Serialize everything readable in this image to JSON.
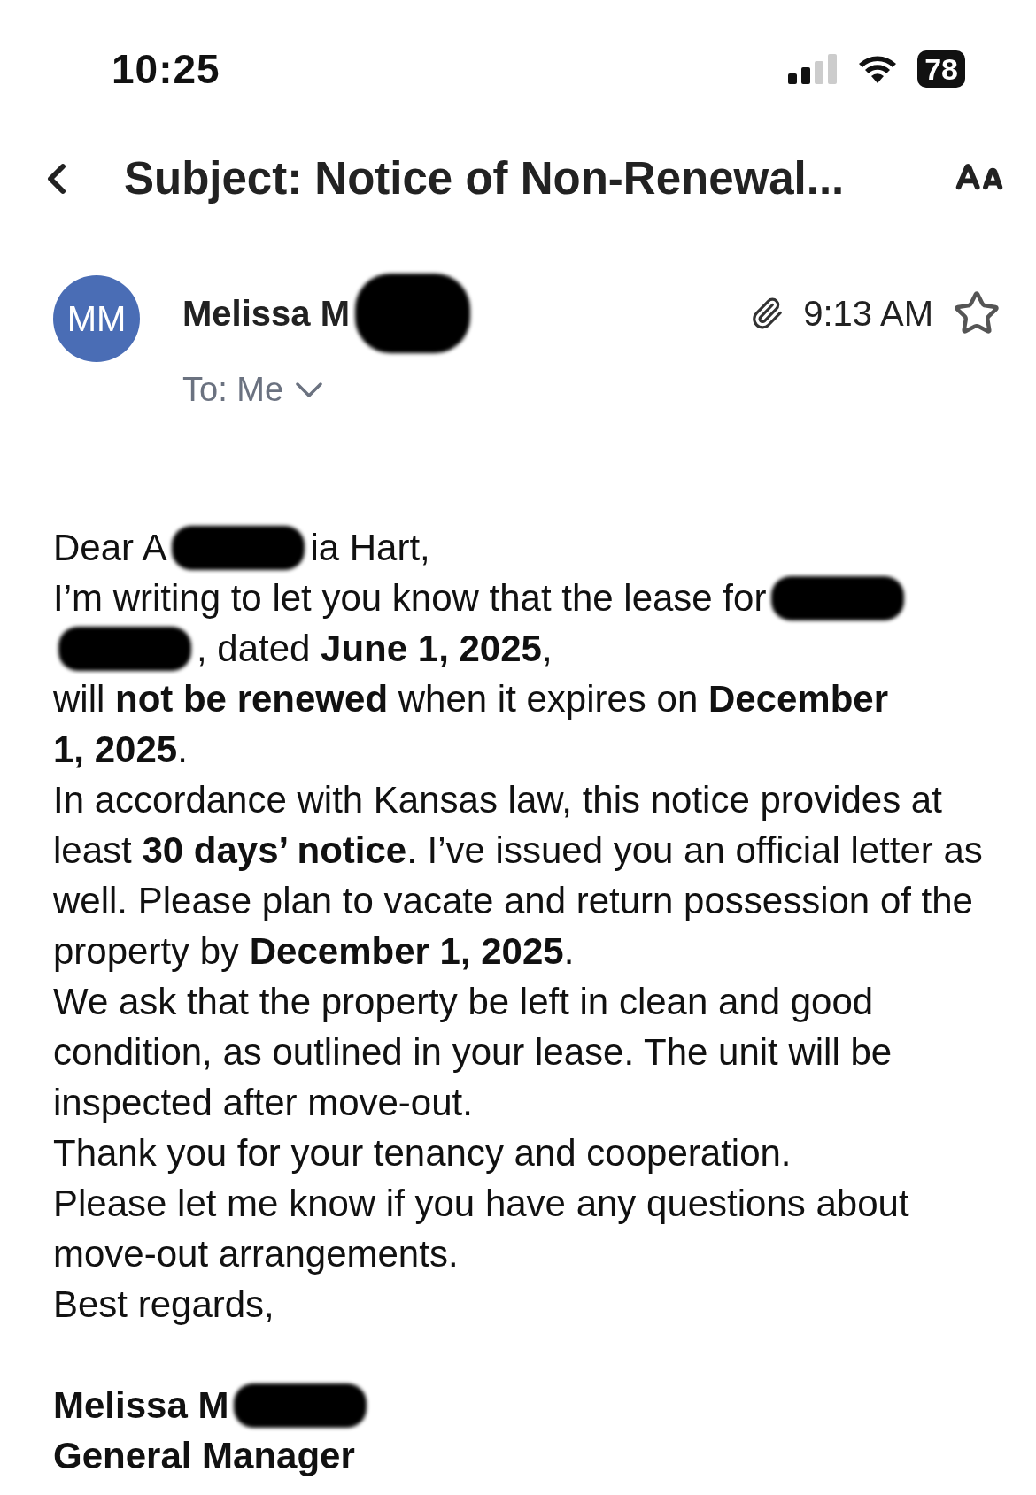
{
  "status_bar": {
    "time": "10:25",
    "battery": "78"
  },
  "header": {
    "title": "Subject: Notice of Non-Renewal..."
  },
  "sender": {
    "initials": "MM",
    "name": [
      {
        "kind": "text",
        "text": "Melissa M"
      },
      {
        "kind": "redaction"
      }
    ],
    "recipient": "To: Me",
    "time": "9:13 AM",
    "has_attachment": true,
    "starred": false
  },
  "body": [
    {
      "kind": "line",
      "segments": [
        {
          "kind": "text",
          "text": "Dear A"
        },
        {
          "kind": "redaction"
        },
        {
          "kind": "text",
          "text": "ia Hart,"
        }
      ]
    },
    {
      "kind": "line",
      "segments": [
        {
          "kind": "text",
          "text": "I’m writing to let you know that the lease for"
        },
        {
          "kind": "redaction"
        }
      ]
    },
    {
      "kind": "line",
      "segments": [
        {
          "kind": "redaction"
        },
        {
          "kind": "text",
          "text": ", dated **June 1, 2025**,"
        }
      ]
    },
    {
      "kind": "line",
      "segments": [
        {
          "kind": "text",
          "text": "will **not be renewed** when it expires on **December**"
        }
      ]
    },
    {
      "kind": "line",
      "segments": [
        {
          "kind": "text",
          "text": "**1, 2025**."
        }
      ]
    },
    {
      "kind": "paragraph",
      "text": "In accordance with Kansas law, this notice provides at least **30 days’ notice**. I’ve issued you an official letter as well. Please plan to vacate and return possession of the property by **December 1, 2025**."
    },
    {
      "kind": "paragraph",
      "text": "We ask that the property be left in clean and good condition, as outlined in your lease. The unit will be inspected after move-out."
    },
    {
      "kind": "paragraph",
      "text": "Thank you for your tenancy and cooperation."
    },
    {
      "kind": "paragraph",
      "text": "Please let me know if you have any questions about move-out arrangements."
    },
    {
      "kind": "paragraph",
      "text": "Best regards,"
    }
  ],
  "signature": [
    {
      "kind": "line",
      "segments": [
        {
          "kind": "text",
          "text": "Melissa M"
        },
        {
          "kind": "redaction"
        }
      ]
    },
    {
      "kind": "line",
      "segments": [
        {
          "kind": "text",
          "text": "General Manager"
        }
      ]
    }
  ]
}
